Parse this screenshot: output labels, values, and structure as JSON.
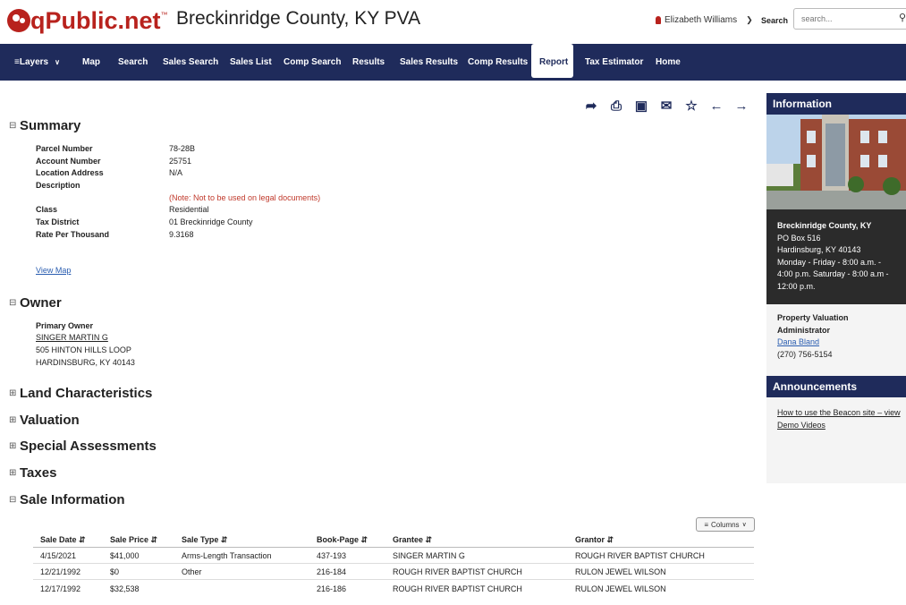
{
  "header": {
    "logo_text": "qPublic.net",
    "logo_tm": "™",
    "site_title": "Breckinridge County, KY PVA",
    "user_name": "Elizabeth Williams",
    "search_label": "Search",
    "search_placeholder": "search..."
  },
  "nav": {
    "items": [
      "Layers",
      "Map",
      "Search",
      "Sales Search",
      "Sales List",
      "Comp Search",
      "Results",
      "Sales Results",
      "Comp Results",
      "Report",
      "Tax Estimator",
      "Home"
    ],
    "active": "Report"
  },
  "summary": {
    "title": "Summary",
    "fields": [
      {
        "label": "Parcel Number",
        "value": "78-28B"
      },
      {
        "label": "Account Number",
        "value": "25751"
      },
      {
        "label": "Location Address",
        "value": "N/A"
      },
      {
        "label": "Description",
        "value": ""
      },
      {
        "label": "Class",
        "value": "Residential"
      },
      {
        "label": "Tax District",
        "value": "01 Breckinridge County"
      },
      {
        "label": "Rate Per Thousand",
        "value": "9.3168"
      }
    ],
    "note": "(Note: Not to be used on legal documents)",
    "view_map": "View Map"
  },
  "owner": {
    "title": "Owner",
    "label": "Primary Owner",
    "name": "SINGER MARTIN G",
    "address1": "505 HINTON HILLS LOOP",
    "address2": "HARDINSBURG, KY 40143"
  },
  "collapsed_sections": [
    "Land Characteristics",
    "Valuation",
    "Special Assessments",
    "Taxes"
  ],
  "sale_info": {
    "title": "Sale Information",
    "columns_button": "Columns",
    "headers": [
      "Sale Date",
      "Sale Price",
      "Sale Type",
      "Book-Page",
      "Grantee",
      "Grantor"
    ],
    "rows": [
      [
        "4/15/2021",
        "$41,000",
        "Arms-Length Transaction",
        "437-193",
        "SINGER MARTIN G",
        "ROUGH RIVER BAPTIST CHURCH"
      ],
      [
        "12/21/1992",
        "$0",
        "Other",
        "216-184",
        "ROUGH RIVER BAPTIST CHURCH",
        "RULON JEWEL WILSON"
      ],
      [
        "12/17/1992",
        "$32,538",
        "",
        "216-186",
        "ROUGH RIVER BAPTIST CHURCH",
        "RULON JEWEL WILSON"
      ]
    ]
  },
  "sidebar": {
    "info_title": "Information",
    "office_name": "Breckinridge County, KY",
    "po_box": "PO Box 516",
    "city": "Hardinsburg, KY 40143",
    "hours": "Monday - Friday - 8:00 a.m. - 4:00 p.m. Saturday - 8:00 a.m - 12:00 p.m.",
    "pva_title": "Property Valuation Administrator",
    "pva_name": "Dana Bland",
    "pva_phone": "(270) 756-5154",
    "announcements_title": "Announcements",
    "announcement_link": "How to use the Beacon site – view Demo Videos"
  },
  "colors": {
    "brand_red": "#b8221d",
    "nav_bg": "#1f2b5b",
    "note_red": "#c0392b",
    "link_blue": "#2a5db0"
  }
}
